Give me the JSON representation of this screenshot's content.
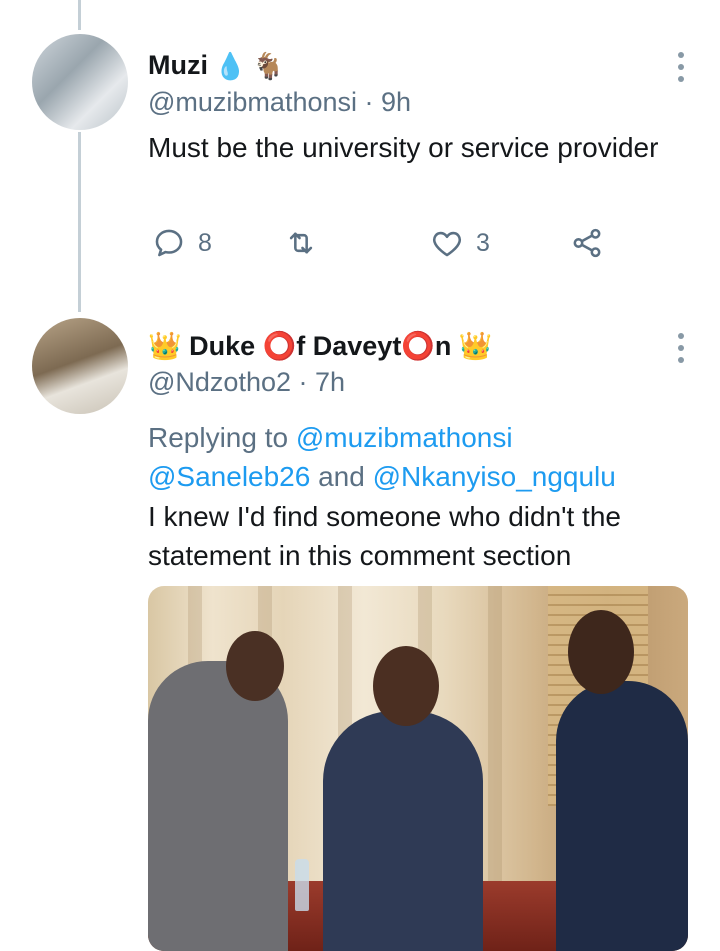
{
  "tweet_1": {
    "display_name": "Muzi",
    "name_emojis": [
      "💧",
      "🐐"
    ],
    "handle": "@muzibmathonsi · 9h",
    "text": "Must be the university or service provider",
    "actions": {
      "reply_count": "8",
      "retweet_count": "",
      "like_count": "3"
    }
  },
  "tweet_2": {
    "display_name": "👑 Duke ⭕f Daveyt⭕n 👑",
    "handle": "@Ndzotho2 · 7h",
    "replying_prefix": "Replying to ",
    "replying_users": [
      "@muzibmathonsi",
      "@Saneleb26",
      "@Nkanyiso_ngqulu"
    ],
    "replying_and": " and ",
    "text": "I knew I'd find someone who didn't the statement in this comment section"
  },
  "colors": {
    "link": "#1d9bf0",
    "secondary_text": "#5b7083",
    "thread_line": "#c4cfd6"
  },
  "icons": [
    "reply-icon",
    "retweet-icon",
    "like-icon",
    "share-icon",
    "more-options-icon"
  ]
}
